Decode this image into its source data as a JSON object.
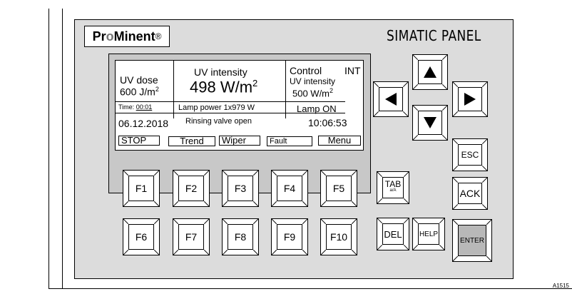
{
  "brand": {
    "logo_text_pre": "Pr",
    "logo_text_o": "o",
    "logo_text_post": "Minent",
    "logo_mark": "®"
  },
  "panel_label": "SIMATIC PANEL",
  "screen": {
    "uv_dose_label": "UV dose",
    "uv_dose_value": "600 J/m",
    "uv_dose_exp": "2",
    "uv_intensity_label": "UV intensity",
    "uv_intensity_value": "498 W/m",
    "uv_intensity_exp": "2",
    "control_label": "Control",
    "control_mode": "INT",
    "control_sub_label": "UV intensity",
    "control_sub_value": "500 W/m",
    "control_sub_exp": "2",
    "time_label": "Time:",
    "time_value": "00:01",
    "lamp_power": "Lamp power 1x979 W",
    "lamp_status": "Lamp ON",
    "date": "06.12.2018",
    "rinsing_status": "Rinsing valve open",
    "clock": "10:06:53",
    "softkeys": [
      "STOP",
      "Trend",
      "Wiper",
      "Fault",
      "Menu"
    ]
  },
  "function_keys_row1": [
    "F1",
    "F2",
    "F3",
    "F4",
    "F5"
  ],
  "function_keys_row2": [
    "F6",
    "F7",
    "F8",
    "F9",
    "F10"
  ],
  "keys": {
    "tab": "TAB",
    "tab_sub": "a/A",
    "del": "DEL",
    "help": "HELP",
    "esc": "ESC",
    "ack": "ACK",
    "enter": "ENTER"
  },
  "reference_code": "A1515"
}
